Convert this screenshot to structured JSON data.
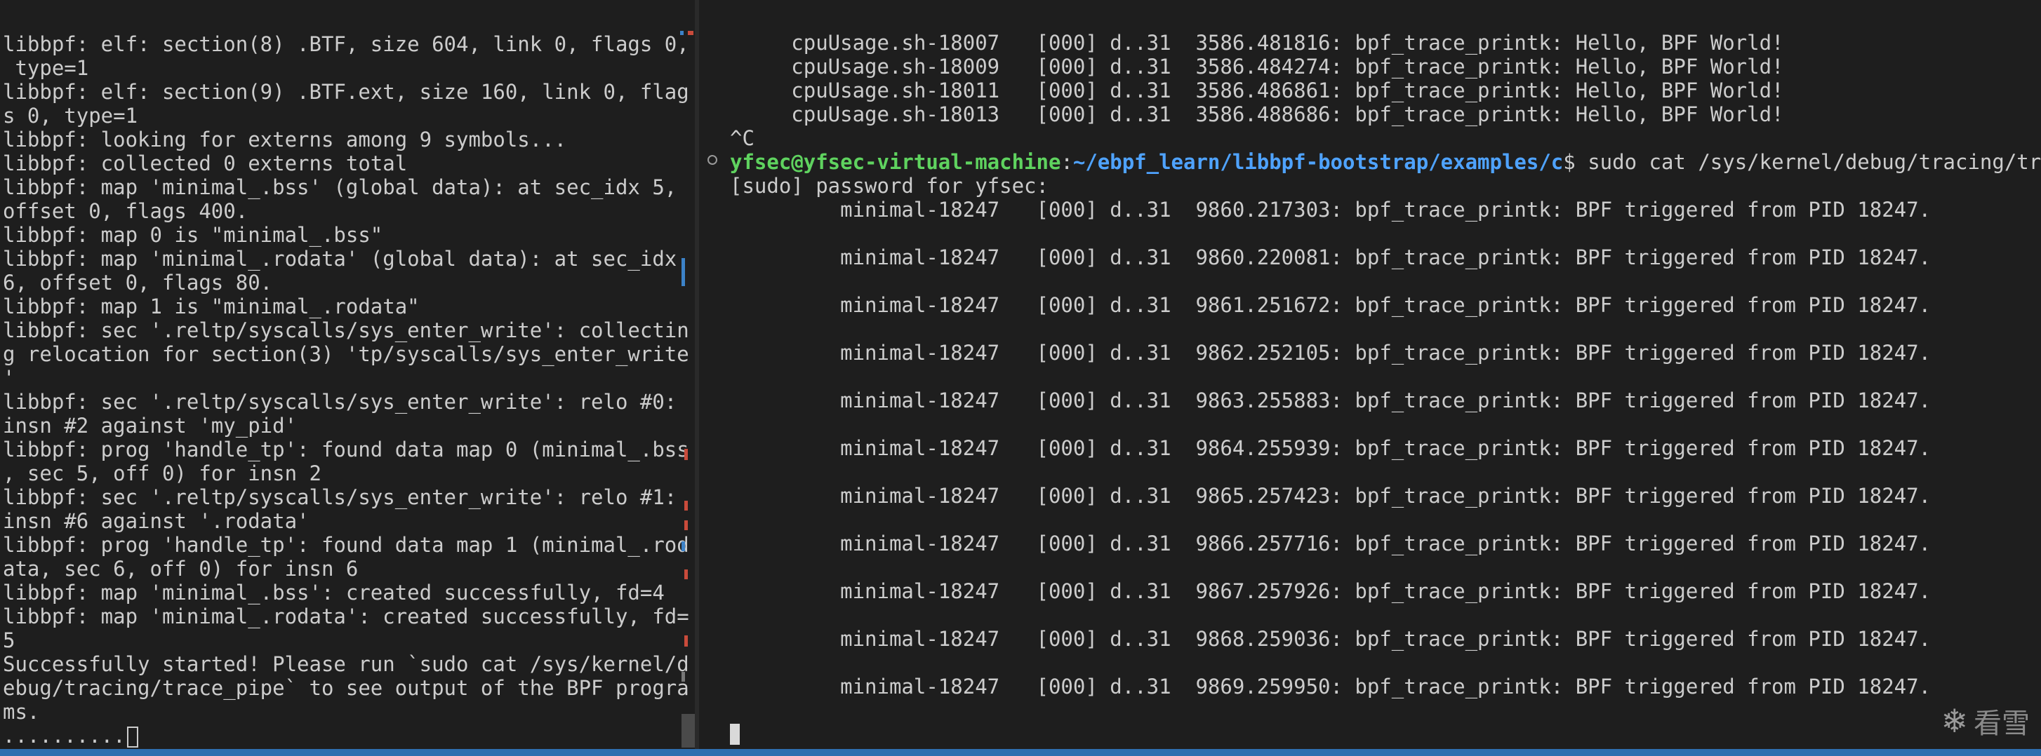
{
  "left_terminal": {
    "lines": [
      "libbpf: elf: section(8) .BTF, size 604, link 0, flags 0,",
      " type=1",
      "libbpf: elf: section(9) .BTF.ext, size 160, link 0, flag",
      "s 0, type=1",
      "libbpf: looking for externs among 9 symbols...",
      "libbpf: collected 0 externs total",
      "libbpf: map 'minimal_.bss' (global data): at sec_idx 5,",
      "offset 0, flags 400.",
      "libbpf: map 0 is \"minimal_.bss\"",
      "libbpf: map 'minimal_.rodata' (global data): at sec_idx",
      "6, offset 0, flags 80.",
      "libbpf: map 1 is \"minimal_.rodata\"",
      "libbpf: sec '.reltp/syscalls/sys_enter_write': collectin",
      "g relocation for section(3) 'tp/syscalls/sys_enter_write",
      "'",
      "libbpf: sec '.reltp/syscalls/sys_enter_write': relo #0:",
      "insn #2 against 'my_pid'",
      "libbpf: prog 'handle_tp': found data map 0 (minimal_.bss",
      ", sec 5, off 0) for insn 2",
      "libbpf: sec '.reltp/syscalls/sys_enter_write': relo #1:",
      "insn #6 against '.rodata'",
      "libbpf: prog 'handle_tp': found data map 1 (minimal_.rod",
      "ata, sec 6, off 0) for insn 6",
      "libbpf: map 'minimal_.bss': created successfully, fd=4",
      "libbpf: map 'minimal_.rodata': created successfully, fd=",
      "5",
      "Successfully started! Please run `sudo cat /sys/kernel/d",
      "ebug/tracing/trace_pipe` to see output of the BPF progra",
      "ms."
    ],
    "progress_line": ".........."
  },
  "right_terminal": {
    "top_lines": [
      "     cpuUsage.sh-18007   [000] d..31  3586.481816: bpf_trace_printk: Hello, BPF World!",
      "     cpuUsage.sh-18009   [000] d..31  3586.484274: bpf_trace_printk: Hello, BPF World!",
      "     cpuUsage.sh-18011   [000] d..31  3586.486861: bpf_trace_printk: Hello, BPF World!",
      "     cpuUsage.sh-18013   [000] d..31  3586.488686: bpf_trace_printk: Hello, BPF World!",
      "^C"
    ],
    "prompt": {
      "user_host": "yfsec@yfsec-virtual-machine",
      "colon": ":",
      "path": "~/ebpf_learn/libbpf-bootstrap/examples/c",
      "dollar": "$",
      "command": " sudo cat /sys/kernel/debug/tracing/trace"
    },
    "sudo_line": "[sudo] password for yfsec:",
    "trace_lines": [
      "         minimal-18247   [000] d..31  9860.217303: bpf_trace_printk: BPF triggered from PID 18247.",
      "",
      "         minimal-18247   [000] d..31  9860.220081: bpf_trace_printk: BPF triggered from PID 18247.",
      "",
      "         minimal-18247   [000] d..31  9861.251672: bpf_trace_printk: BPF triggered from PID 18247.",
      "",
      "         minimal-18247   [000] d..31  9862.252105: bpf_trace_printk: BPF triggered from PID 18247.",
      "",
      "         minimal-18247   [000] d..31  9863.255883: bpf_trace_printk: BPF triggered from PID 18247.",
      "",
      "         minimal-18247   [000] d..31  9864.255939: bpf_trace_printk: BPF triggered from PID 18247.",
      "",
      "         minimal-18247   [000] d..31  9865.257423: bpf_trace_printk: BPF triggered from PID 18247.",
      "",
      "         minimal-18247   [000] d..31  9866.257716: bpf_trace_printk: BPF triggered from PID 18247.",
      "",
      "         minimal-18247   [000] d..31  9867.257926: bpf_trace_printk: BPF triggered from PID 18247.",
      "",
      "         minimal-18247   [000] d..31  9868.259036: bpf_trace_printk: BPF triggered from PID 18247.",
      "",
      "         minimal-18247   [000] d..31  9869.259950: bpf_trace_printk: BPF triggered from PID 18247."
    ]
  },
  "watermark": {
    "icon": "snowflake-icon",
    "text": "看雪"
  },
  "colors": {
    "background": "#1e1e1e",
    "text": "#cccccc",
    "prompt_user": "#5fd35f",
    "prompt_path": "#4fa3ff",
    "status_bar": "#2f6fb0"
  }
}
